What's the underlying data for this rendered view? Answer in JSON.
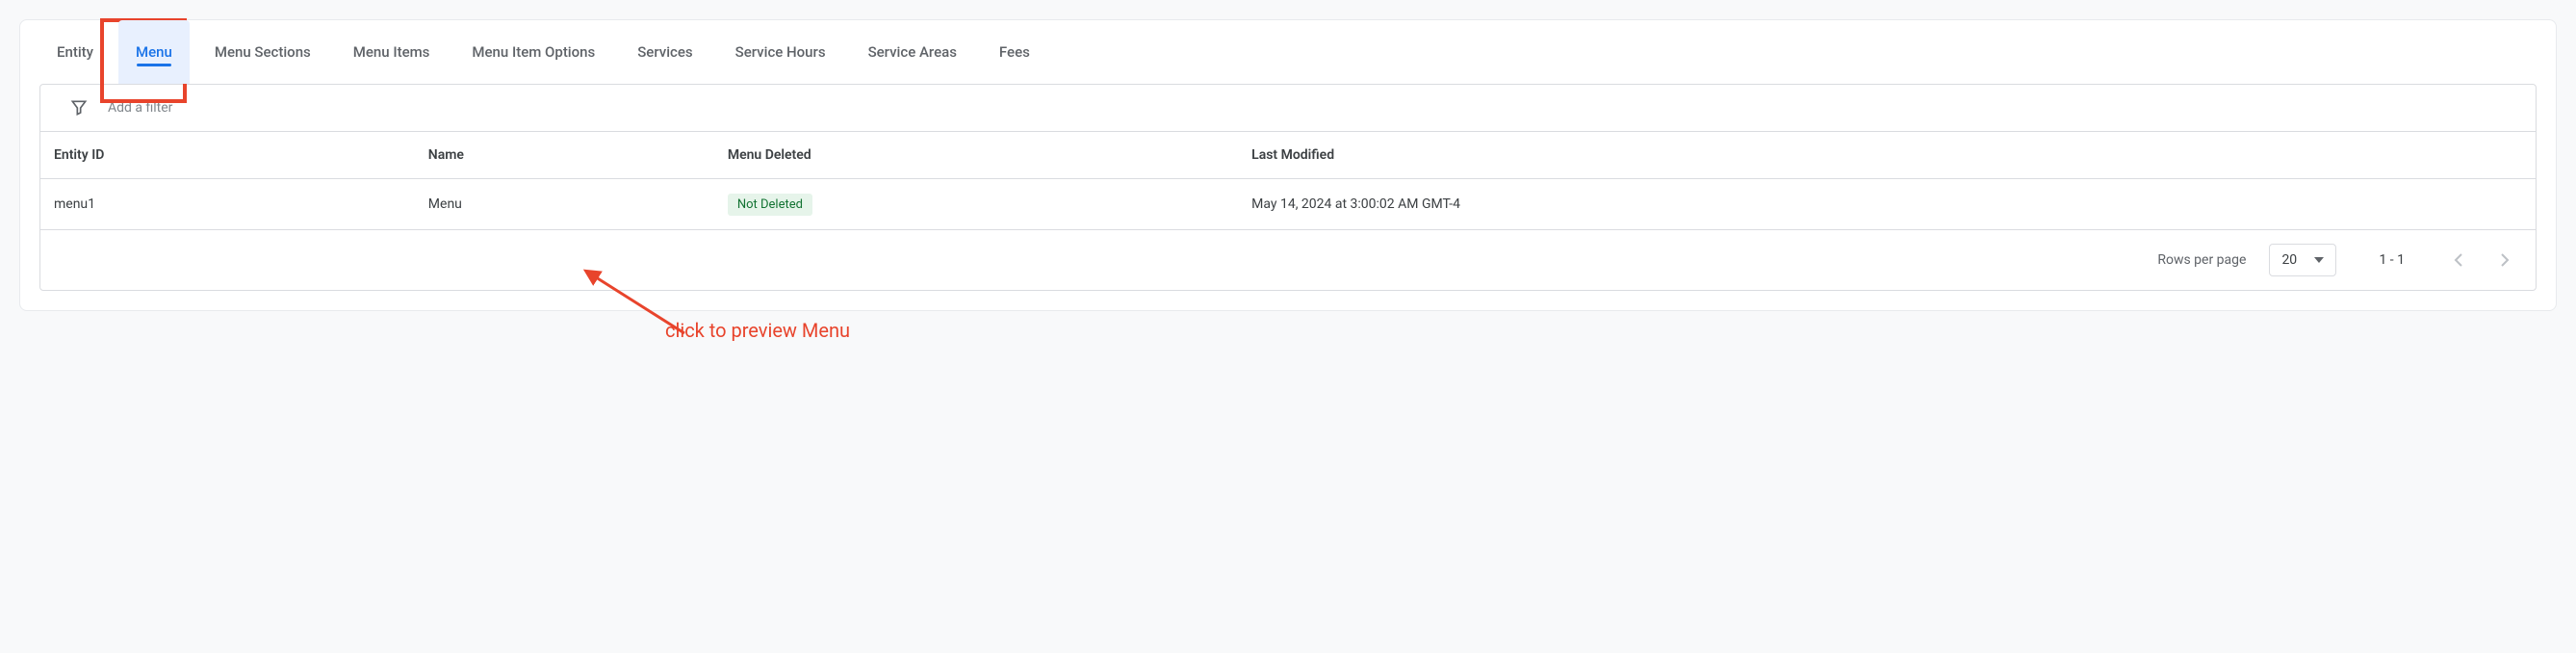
{
  "tabs": [
    {
      "label": "Entity",
      "active": false
    },
    {
      "label": "Menu",
      "active": true
    },
    {
      "label": "Menu Sections",
      "active": false
    },
    {
      "label": "Menu Items",
      "active": false
    },
    {
      "label": "Menu Item Options",
      "active": false
    },
    {
      "label": "Services",
      "active": false
    },
    {
      "label": "Service Hours",
      "active": false
    },
    {
      "label": "Service Areas",
      "active": false
    },
    {
      "label": "Fees",
      "active": false
    }
  ],
  "filter": {
    "placeholder": "Add a filter"
  },
  "table": {
    "columns": [
      "Entity ID",
      "Name",
      "Menu Deleted",
      "Last Modified"
    ],
    "rows": [
      {
        "entity_id": "menu1",
        "name": "Menu",
        "deleted_status": "Not Deleted",
        "last_modified": "May 14, 2024 at 3:00:02 AM GMT-4"
      }
    ]
  },
  "pagination": {
    "rows_label": "Rows per page",
    "rows_per_page": "20",
    "range": "1 - 1"
  },
  "annotation": {
    "text": "click to preview Menu"
  }
}
